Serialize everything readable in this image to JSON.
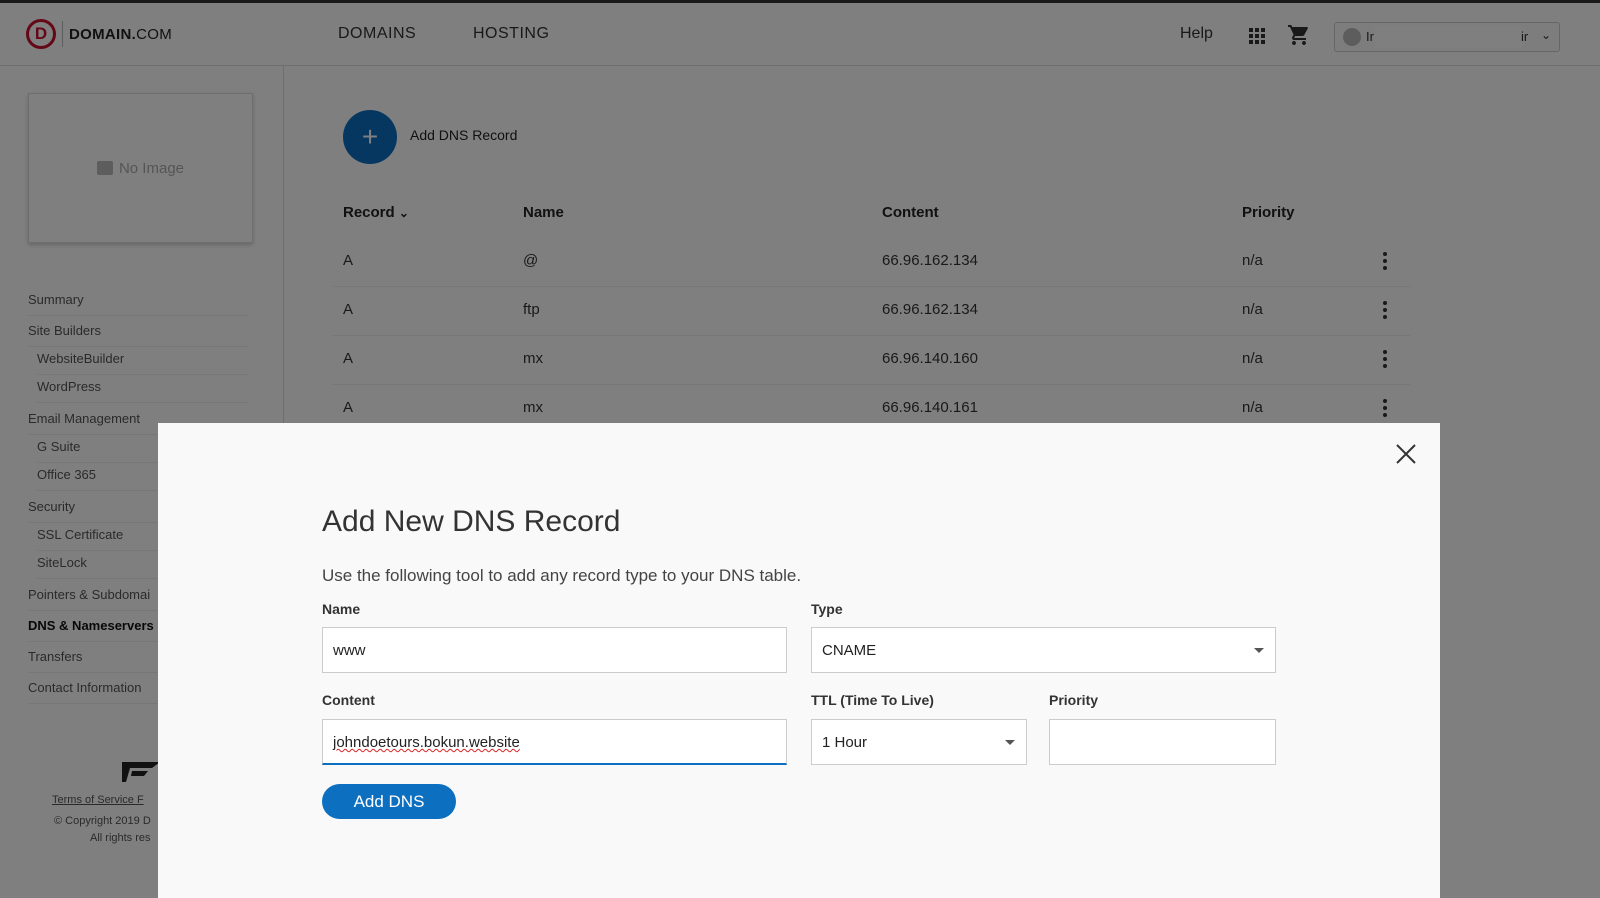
{
  "header": {
    "logo_mark": "D",
    "logo_bold": "DOMAIN.",
    "logo_rest": "COM",
    "nav": [
      "DOMAINS",
      "HOSTING"
    ],
    "help": "Help",
    "user_name_start": "Ir",
    "user_name_end": "ir"
  },
  "sidebar": {
    "no_image": "No Image",
    "items": [
      {
        "label": "Summary",
        "sub": false
      },
      {
        "label": "Site Builders",
        "sub": false
      },
      {
        "label": "WebsiteBuilder",
        "sub": true
      },
      {
        "label": "WordPress",
        "sub": true
      },
      {
        "label": "Email Management",
        "sub": false
      },
      {
        "label": "G Suite",
        "sub": true
      },
      {
        "label": "Office 365",
        "sub": true
      },
      {
        "label": "Security",
        "sub": false
      },
      {
        "label": "SSL Certificate",
        "sub": true
      },
      {
        "label": "SiteLock",
        "sub": true
      },
      {
        "label": "Pointers & Subdomai",
        "sub": false
      },
      {
        "label": "DNS & Nameservers",
        "sub": false,
        "active": true
      },
      {
        "label": "Transfers",
        "sub": false
      },
      {
        "label": "Contact Information",
        "sub": false
      }
    ],
    "footer_links": "Terms of Service   F",
    "footer_copy": "© Copyright 2019 D",
    "footer_rights": "All rights res"
  },
  "main": {
    "add_record_label": "Add DNS Record",
    "table": {
      "headers": [
        "Record",
        "Name",
        "Content",
        "Priority"
      ],
      "rows": [
        {
          "record": "A",
          "name": "@",
          "content": "66.96.162.134",
          "priority": "n/a"
        },
        {
          "record": "A",
          "name": "ftp",
          "content": "66.96.162.134",
          "priority": "n/a"
        },
        {
          "record": "A",
          "name": "mx",
          "content": "66.96.140.160",
          "priority": "n/a"
        },
        {
          "record": "A",
          "name": "mx",
          "content": "66.96.140.161",
          "priority": "n/a"
        }
      ]
    }
  },
  "modal": {
    "title": "Add New DNS Record",
    "description": "Use the following tool to add any record type to your DNS table.",
    "name_label": "Name",
    "name_value": "www",
    "type_label": "Type",
    "type_value": "CNAME",
    "content_label": "Content",
    "content_value": "johndoetours.bokun.website",
    "ttl_label": "TTL (Time To Live)",
    "ttl_value": "1 Hour",
    "priority_label": "Priority",
    "priority_value": "",
    "submit_label": "Add DNS"
  },
  "colors": {
    "accent": "#0d6fc0",
    "brand": "#c8102e"
  }
}
